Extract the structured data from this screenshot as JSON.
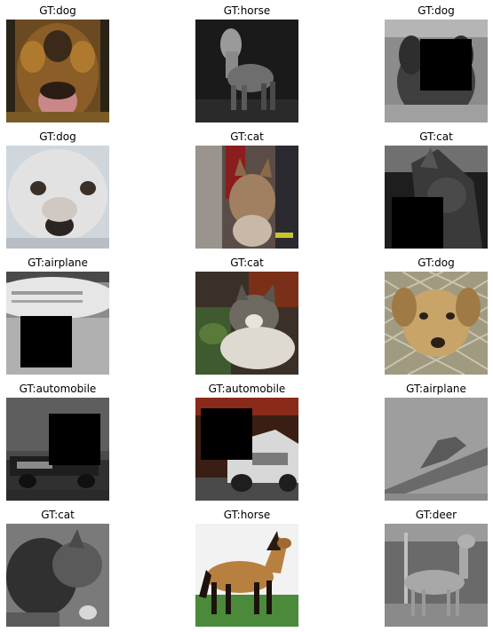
{
  "grid": {
    "cells": [
      {
        "title": "GT:dog"
      },
      {
        "title": "GT:horse"
      },
      {
        "title": "GT:dog"
      },
      {
        "title": "GT:dog"
      },
      {
        "title": "GT:cat"
      },
      {
        "title": "GT:cat"
      },
      {
        "title": "GT:airplane"
      },
      {
        "title": "GT:cat"
      },
      {
        "title": "GT:dog"
      },
      {
        "title": "GT:automobile"
      },
      {
        "title": "GT:automobile"
      },
      {
        "title": "GT:airplane"
      },
      {
        "title": "GT:cat"
      },
      {
        "title": "GT:horse"
      },
      {
        "title": "GT:deer"
      }
    ]
  }
}
